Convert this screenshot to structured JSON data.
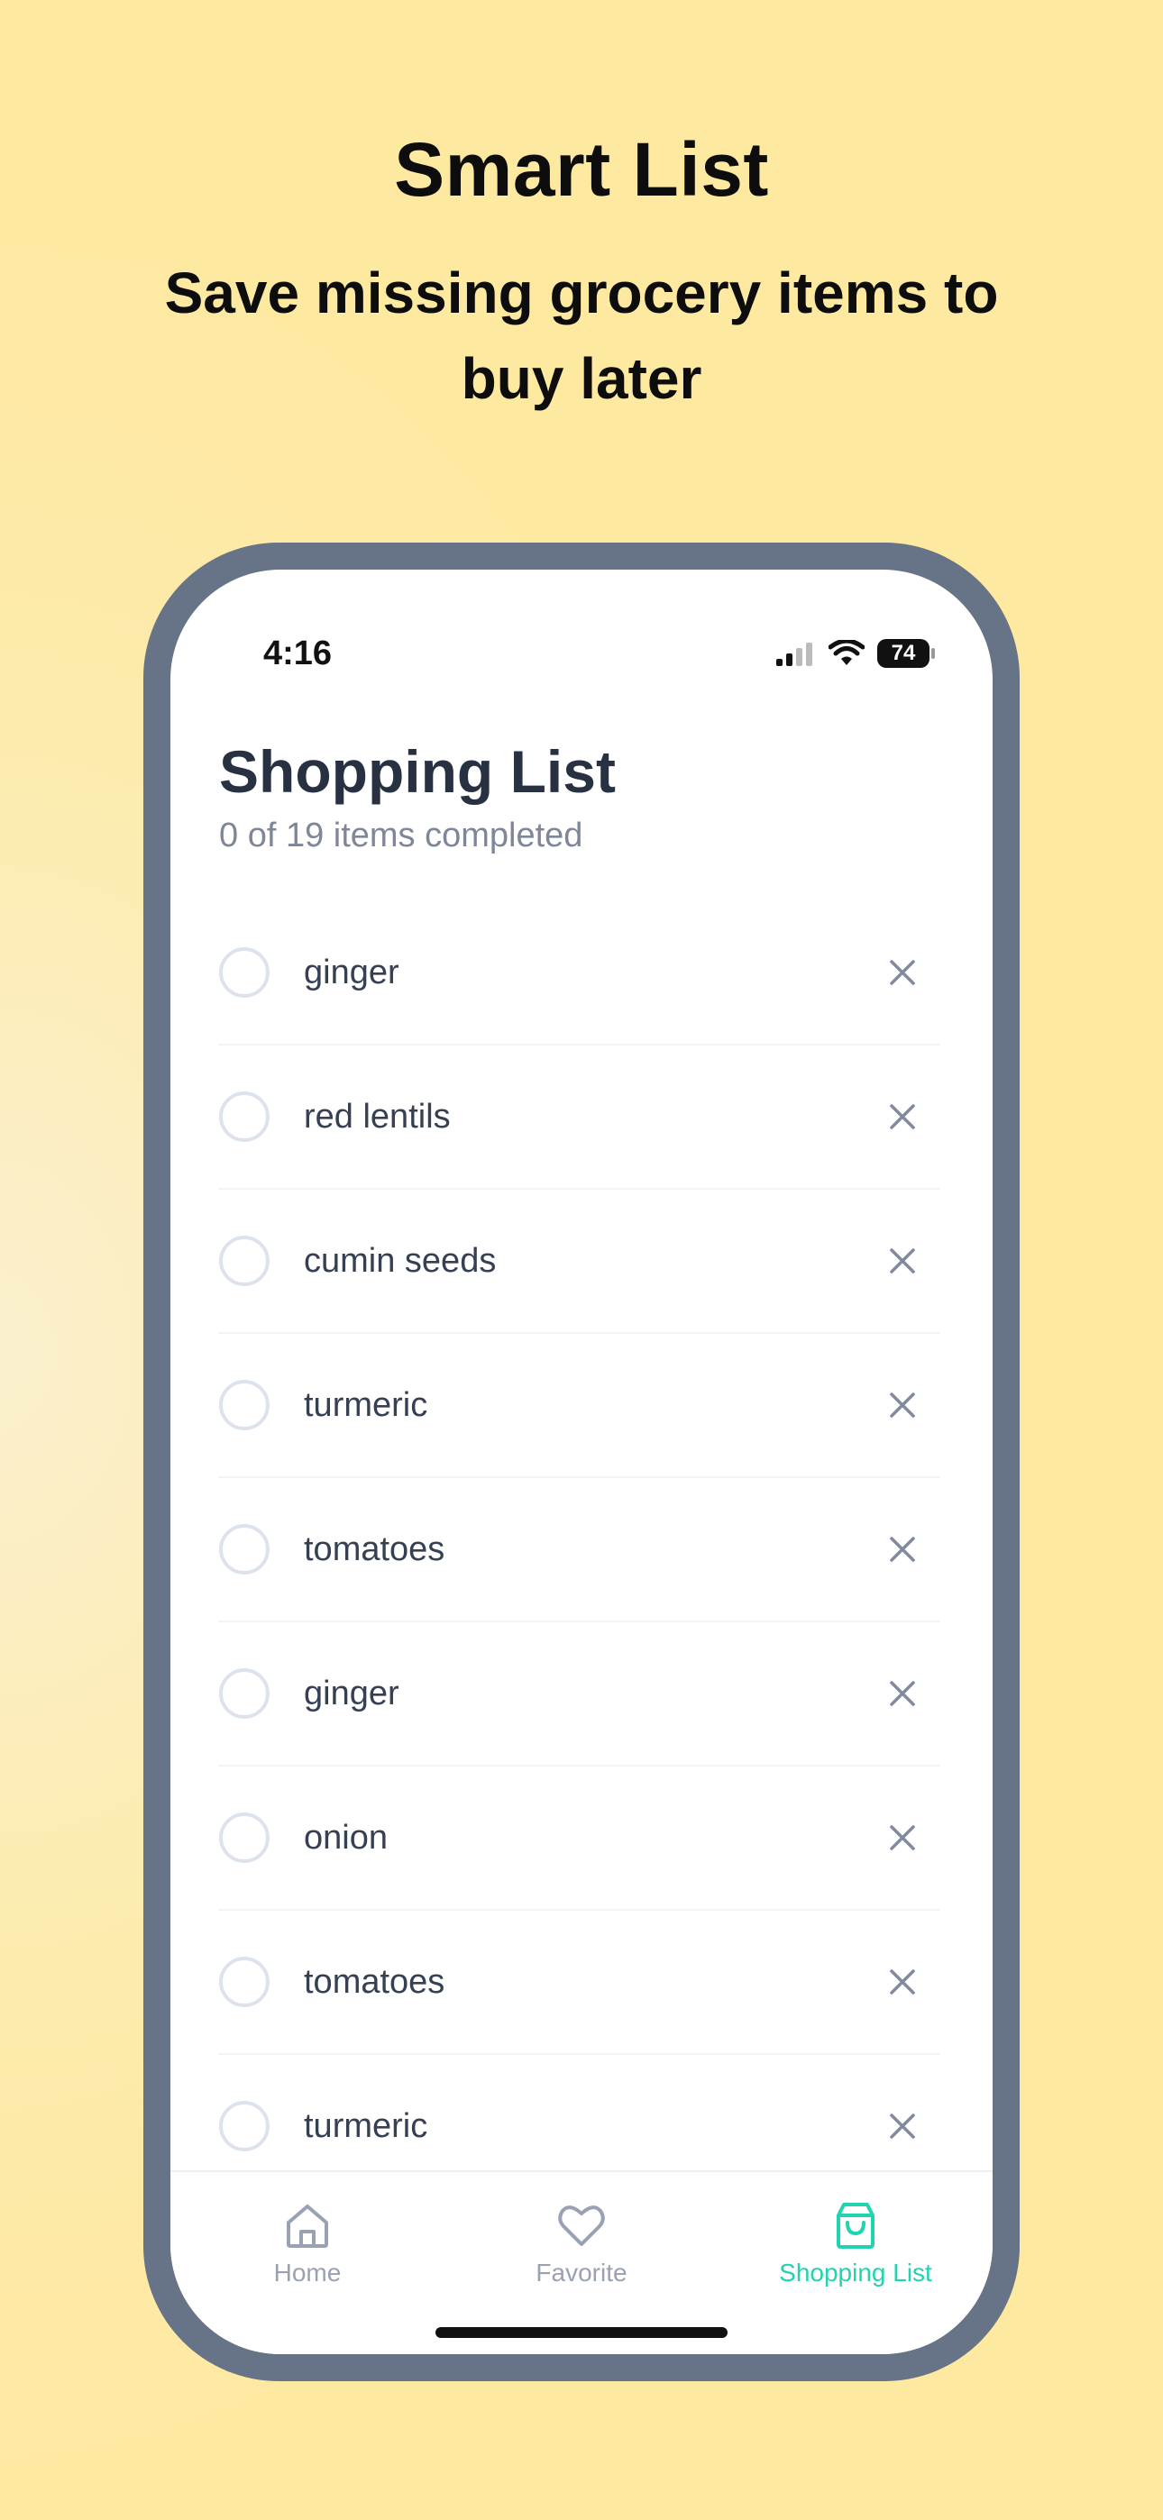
{
  "promo": {
    "title": "Smart List",
    "subtitle": "Save missing grocery items to buy later"
  },
  "status_bar": {
    "time": "4:16",
    "battery": "74"
  },
  "page": {
    "title": "Shopping List",
    "subtitle": "0 of 19 items completed"
  },
  "items": [
    {
      "label": "ginger"
    },
    {
      "label": "red lentils"
    },
    {
      "label": "cumin seeds"
    },
    {
      "label": "turmeric"
    },
    {
      "label": "tomatoes"
    },
    {
      "label": "ginger"
    },
    {
      "label": "onion"
    },
    {
      "label": "tomatoes"
    },
    {
      "label": "turmeric"
    }
  ],
  "tabs": [
    {
      "label": "Home",
      "icon": "home-icon",
      "active": false
    },
    {
      "label": "Favorite",
      "icon": "heart-icon",
      "active": false
    },
    {
      "label": "Shopping List",
      "icon": "shopping-bag-icon",
      "active": true
    }
  ],
  "colors": {
    "background": "#fee9a0",
    "frame": "#677386",
    "accent": "#22d3b0",
    "title": "#273142",
    "muted": "#7d8798"
  }
}
